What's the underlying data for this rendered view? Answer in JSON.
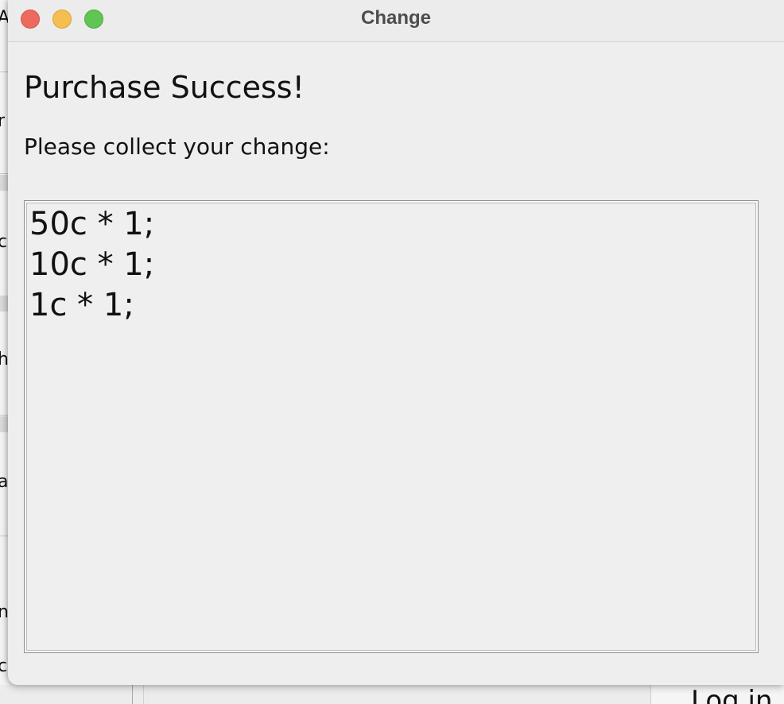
{
  "window": {
    "title": "Change"
  },
  "dialog": {
    "heading": "Purchase Success!",
    "instruction": "Please collect your change:",
    "change_lines": [
      "50c * 1;",
      "10c * 1;",
      "1c * 1;"
    ]
  },
  "background_window": {
    "clipped_letters": [
      "A",
      "r",
      "c",
      "h",
      "a",
      "n",
      "c"
    ],
    "login_button_label": "Log in"
  },
  "colors": {
    "close_button": "#ec6a5e",
    "minimize_button": "#f5bf4f",
    "zoom_button": "#61c554",
    "dialog_background": "#eeeeee",
    "title_text": "#4d4d4d"
  },
  "icons": {
    "close": "close-icon",
    "minimize": "minimize-icon",
    "zoom": "zoom-icon"
  }
}
